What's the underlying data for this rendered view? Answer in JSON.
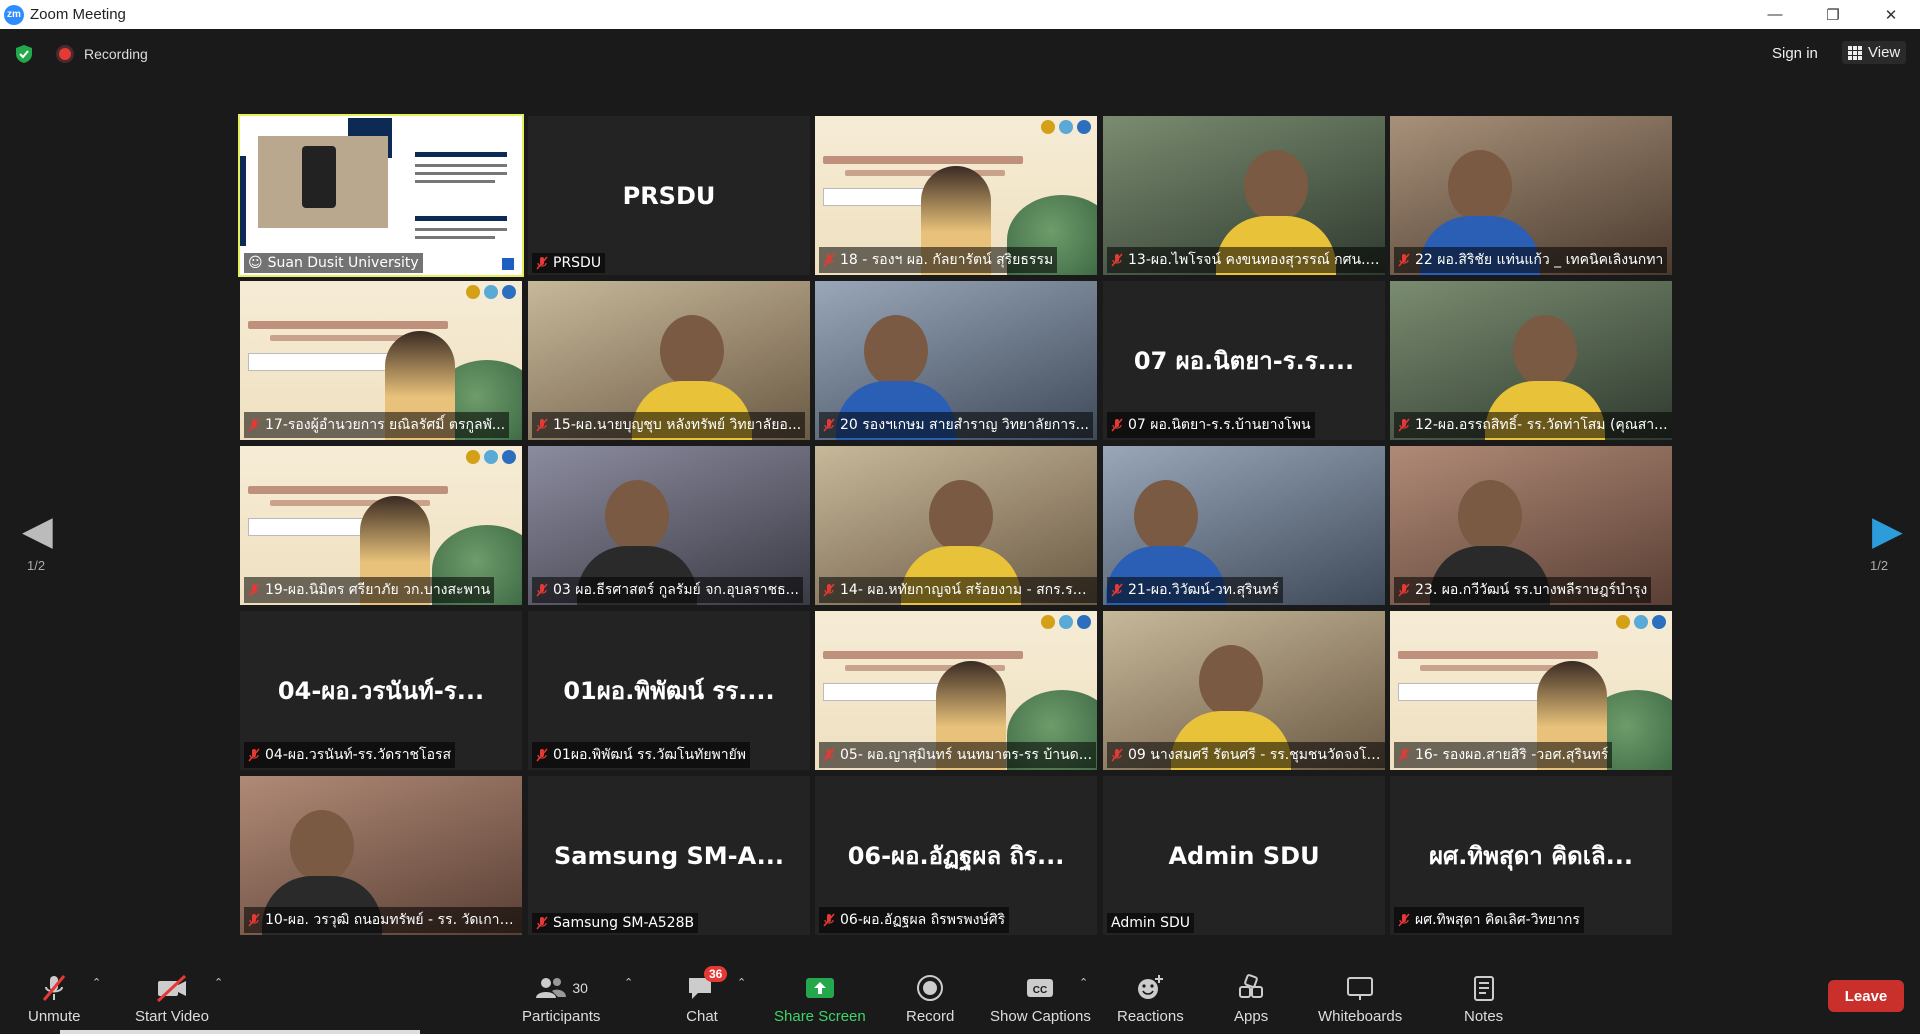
{
  "window": {
    "title": "Zoom Meeting",
    "logo": "zm"
  },
  "topbar": {
    "recording_label": "Recording",
    "signin_label": "Sign in",
    "view_label": "View"
  },
  "pager": {
    "left_page": "1/2",
    "right_page": "1/2"
  },
  "tiles": [
    {
      "name": "Suan Dusit University",
      "big": "",
      "kind": "share"
    },
    {
      "name": "PRSDU",
      "big": "PRSDU",
      "kind": "name"
    },
    {
      "name": "18 - รองฯ ผอ. กัลยารัตน์  สุริยธรรม",
      "big": "",
      "kind": "slide"
    },
    {
      "name": "13-ผอ.ไพโรจน์ คงขนทองสุวรรณ์ กศน.อ...",
      "big": "",
      "kind": "video"
    },
    {
      "name": "22 ผอ.สิริชัย แท่นแก้ว _ เทคนิคเลิงนกทา",
      "big": "",
      "kind": "video"
    },
    {
      "name": "17-รองผู้อำนวยการ ยณิลรัศมิ์ ตรกูลพั...",
      "big": "",
      "kind": "slide"
    },
    {
      "name": "15-ผอ.นายบุญชุบ หลังทรัพย์ วิทยาลัยอ...",
      "big": "",
      "kind": "video"
    },
    {
      "name": "20 รองฯเกษม สายสำราญ  วิทยาลัยการ...",
      "big": "",
      "kind": "video"
    },
    {
      "name": "07 ผอ.นิตยา-ร.ร.บ้านยางโพน",
      "big": "07 ผอ.นิตยา-ร.ร....",
      "kind": "name"
    },
    {
      "name": "12-ผอ.อรรถสิทธิ์- รร.วัดท่าโสม (คุณสา...",
      "big": "",
      "kind": "video"
    },
    {
      "name": "19-ผอ.นิมิตร ศรียาภัย  วก.บางสะพาน",
      "big": "",
      "kind": "slide"
    },
    {
      "name": "03 ผอ.ธีรศาสตร์ กูลรัมย์ จก.อุบลราชธ...",
      "big": "",
      "kind": "video"
    },
    {
      "name": "14- ผอ.หทัยกาญจน์ สร้อยงาม - สกร.ระ...",
      "big": "",
      "kind": "video"
    },
    {
      "name": "21-ผอ.วิวัฒน์-วท.สุรินทร์",
      "big": "",
      "kind": "video"
    },
    {
      "name": "23. ผอ.กวีวัฒน์  รร.บางพลีราษฎร์บำรุง",
      "big": "",
      "kind": "video"
    },
    {
      "name": "04-ผอ.วรนันท์-รร.วัดราชโอรส",
      "big": "04-ผอ.วรนันท์-ร...",
      "kind": "name"
    },
    {
      "name": "01ผอ.พิพัฒน์ รร.วัฒโนทัยพายัพ",
      "big": "01ผอ.พิพัฒน์ รร....",
      "kind": "name"
    },
    {
      "name": "05- ผอ.ญาสุมินทร์ นนทมาตร-รร บ้านด...",
      "big": "",
      "kind": "slide"
    },
    {
      "name": "09 นางสมศรี รัตนศรี - รร.ชุมชนวัดจงโก...",
      "big": "",
      "kind": "video"
    },
    {
      "name": "16- รองผอ.สายสิริ -วอศ.สุรินทร์",
      "big": "",
      "kind": "slide"
    },
    {
      "name": "10-ผอ. วรวุฒิ ถนอมทรัพย์ - รร. วัดเกาะ...",
      "big": "",
      "kind": "video"
    },
    {
      "name": "Samsung SM-A528B",
      "big": "Samsung  SM-A...",
      "kind": "name"
    },
    {
      "name": "06-ผอ.อัฏฐผล ถิรพรพงษ์ศิริ",
      "big": "06-ผอ.อัฏฐผล ถิร...",
      "kind": "name"
    },
    {
      "name": "Admin SDU",
      "big": "Admin SDU",
      "kind": "name"
    },
    {
      "name": "ผศ.ทิพสุดา คิดเลิศ-วิทยากร",
      "big": "ผศ.ทิพสุดา คิดเลิ...",
      "kind": "name"
    }
  ],
  "toolbar": {
    "unmute": "Unmute",
    "start_video": "Start Video",
    "participants": "Participants",
    "participants_count": "30",
    "chat": "Chat",
    "chat_badge": "36",
    "share_screen": "Share Screen",
    "record": "Record",
    "show_captions": "Show Captions",
    "reactions": "Reactions",
    "apps": "Apps",
    "whiteboards": "Whiteboards",
    "notes": "Notes",
    "leave": "Leave"
  },
  "colors": {
    "active_outline": "#e3f25a",
    "share_green": "#23a94b",
    "leave_red": "#c9302c",
    "badge_red": "#e53935",
    "next_arrow": "#2d9cdb"
  }
}
